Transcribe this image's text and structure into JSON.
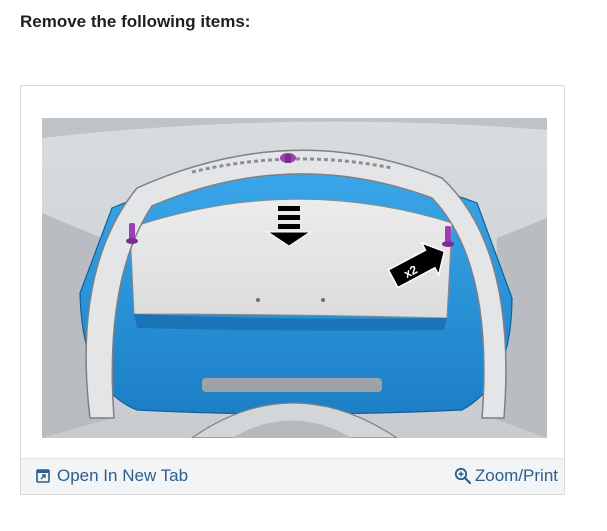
{
  "page": {
    "heading": "Remove the following items:"
  },
  "figure": {
    "callout_label": "x2",
    "colors": {
      "trim_panel": "#2b97dd",
      "fastener": "#9b3fb2",
      "link": "#2c5f8e"
    }
  },
  "footer": {
    "open_new_tab": {
      "label": "Open In New Tab",
      "icon": "open-in-new-tab-icon"
    },
    "zoom_print": {
      "label": "Zoom/Print",
      "icon": "zoom-in-icon"
    }
  }
}
